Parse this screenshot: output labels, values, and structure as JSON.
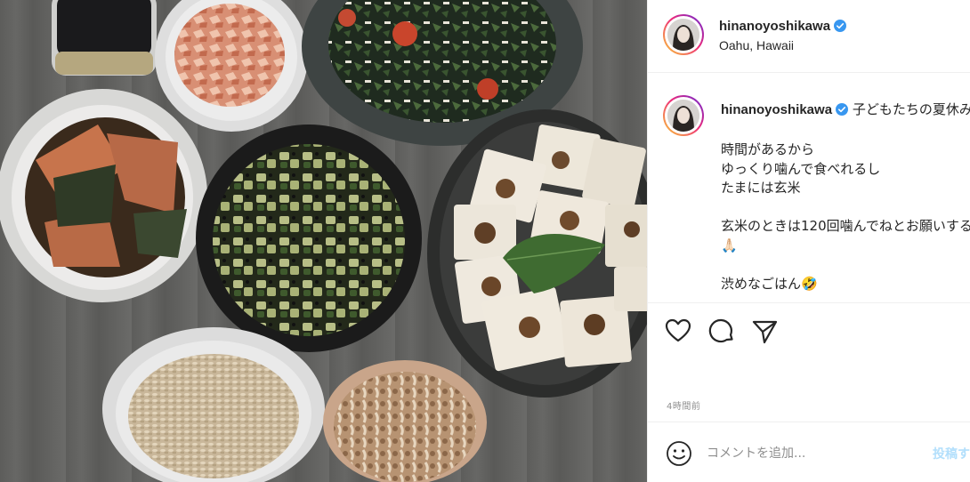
{
  "post": {
    "photo_alt": "",
    "author": {
      "username": "hinanoyoshikawa",
      "verified": true,
      "location": "Oahu, Hawaii"
    },
    "caption": {
      "username": "hinanoyoshikawa",
      "text": " 子どもたちの夏休み\n\n時間があるから\nゆっくり噛んで食べれるし\nたまには玄米\n\n玄米のときは120回噛んでねとお願いする🙏🏻\n\n渋めなごはん🤣"
    },
    "timestamp": "4時間前",
    "comment": {
      "placeholder": "コメントを追加...",
      "post_label": "投稿する"
    },
    "icons": {
      "like": "heart-icon",
      "comment": "comment-bubble-icon",
      "share": "paper-plane-icon",
      "emoji": "smiley-icon",
      "verified": "verified-badge-icon"
    },
    "colors": {
      "verified": "#3897f0",
      "post_button": "#b2dffc",
      "ring_start": "#f9ce34",
      "ring_mid": "#ee2a7b",
      "ring_end": "#6228d7"
    }
  }
}
